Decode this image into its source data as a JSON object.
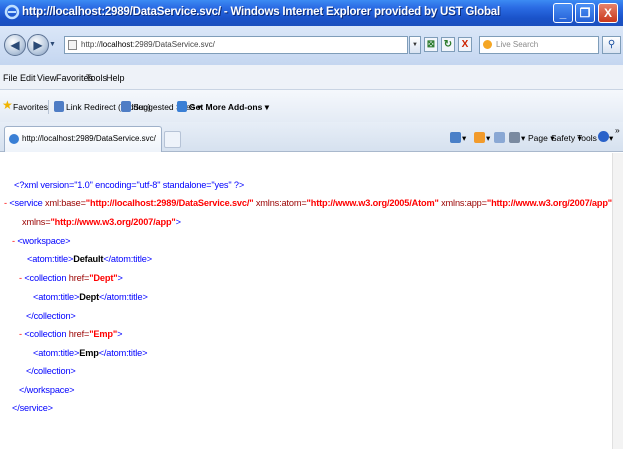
{
  "window": {
    "title": "http://localhost:2989/DataService.svc/ - Windows Internet Explorer provided by UST Global",
    "minimize": "_",
    "maximize": "❐",
    "close": "X"
  },
  "address_bar": {
    "prefix": "http://",
    "host": "localhost",
    "path": ":2989/DataService.svc/",
    "search_placeholder": "Live Search",
    "go_label": "→",
    "compat_label": "⊠",
    "refresh_label": "↻",
    "stop_label": "X",
    "back_label": "◀",
    "forward_label": "▶"
  },
  "menu": {
    "file": "File",
    "edit": "Edit",
    "view": "View",
    "favorites": "Favorites",
    "tools": "Tools",
    "help": "Help"
  },
  "favorites_bar": {
    "favorites": "Favorites",
    "link_redirect": "Link Redirect (Hidden)",
    "suggested_sites": "Suggested Sites ▾",
    "get_addons": "Get More Add-ons ▾"
  },
  "tab": {
    "label": "http://localhost:2989/DataService.svc/"
  },
  "commandbar": {
    "page": "Page ▾",
    "safety": "Safety ▾",
    "tools": "Tools ▾",
    "help": "▾",
    "more": "»"
  },
  "xml": {
    "declaration": "<?xml version=\"1.0\" encoding=\"utf-8\" standalone=\"yes\" ?>",
    "minus": "-",
    "service_open": "<service",
    "xml_base_attr": "xml:base=",
    "xml_base_value": "\"http://localhost:2989/DataService.svc/\"",
    "xmlns_atom_attr": "xmlns:atom=",
    "xmlns_atom_value": "\"http://www.w3.org/2005/Atom\"",
    "xmlns_app_attr": "xmlns:app=",
    "xmlns_app_value": "\"http://www.w3.org/2007/app\"",
    "xmlns_attr": "xmlns=",
    "xmlns_value": "\"http://www.w3.org/2007/app\"",
    "close_bracket": ">",
    "workspace_open": "<workspace>",
    "atom_title_open": "<atom:title>",
    "atom_title_close": "</atom:title>",
    "default_title": "Default",
    "collection_open": "<collection",
    "href_attr": "href=",
    "dept_href": "\"Dept\"",
    "dept_title": "Dept",
    "emp_href": "\"Emp\"",
    "emp_title": "Emp",
    "collection_close": "</collection>",
    "workspace_close": "</workspace>",
    "service_close": "</service>"
  }
}
